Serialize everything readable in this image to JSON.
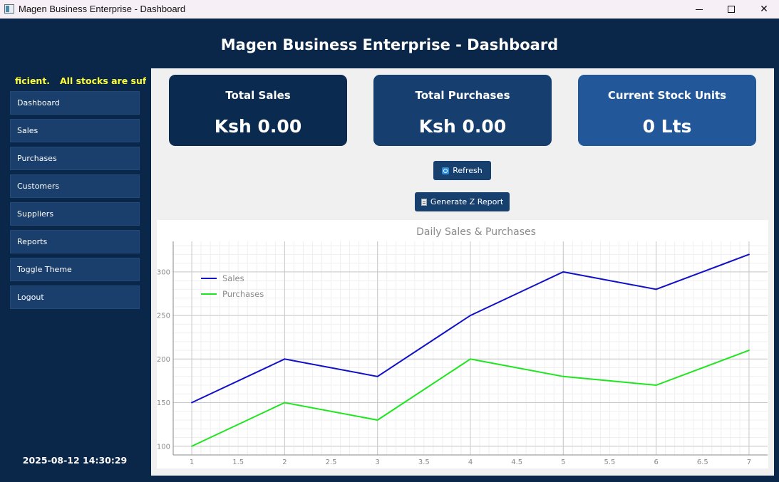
{
  "window": {
    "title": "Magen Business Enterprise - Dashboard"
  },
  "header": {
    "title": "Magen Business Enterprise - Dashboard"
  },
  "sidebar": {
    "ticker_left": "ficient.",
    "ticker_right": "All stocks are suf",
    "items": [
      {
        "label": "Dashboard"
      },
      {
        "label": "Sales"
      },
      {
        "label": "Purchases"
      },
      {
        "label": "Customers"
      },
      {
        "label": "Suppliers"
      },
      {
        "label": "Reports"
      },
      {
        "label": "Toggle Theme"
      },
      {
        "label": "Logout"
      }
    ],
    "datetime": "2025-08-12 14:30:29"
  },
  "cards": {
    "sales": {
      "label": "Total Sales",
      "value": "Ksh 0.00"
    },
    "purchases": {
      "label": "Total Purchases",
      "value": "Ksh 0.00"
    },
    "stock": {
      "label": "Current Stock Units",
      "value": "0 Lts"
    }
  },
  "actions": {
    "refresh_label": "Refresh",
    "refresh_icon": "refresh-icon",
    "zreport_label": "Generate Z Report",
    "zreport_icon": "document-icon"
  },
  "colors": {
    "sales_line": "#1010c8",
    "purchases_line": "#1ee61e"
  },
  "chart_data": {
    "type": "line",
    "title": "Daily Sales & Purchases",
    "xlabel": "",
    "ylabel": "",
    "xlim": [
      0.8,
      7.2
    ],
    "ylim": [
      90,
      335
    ],
    "xticks": [
      "1",
      "1.5",
      "2",
      "2.5",
      "3",
      "3.5",
      "4",
      "4.5",
      "5",
      "5.5",
      "6",
      "6.5",
      "7"
    ],
    "yticks": [
      "100",
      "150",
      "200",
      "250",
      "300"
    ],
    "grid": true,
    "legend": "top-left",
    "x": [
      1,
      2,
      3,
      4,
      5,
      6,
      7
    ],
    "series": [
      {
        "name": "Sales",
        "values": [
          150,
          200,
          180,
          250,
          300,
          280,
          320
        ]
      },
      {
        "name": "Purchases",
        "values": [
          100,
          150,
          130,
          200,
          180,
          170,
          210
        ]
      }
    ]
  }
}
